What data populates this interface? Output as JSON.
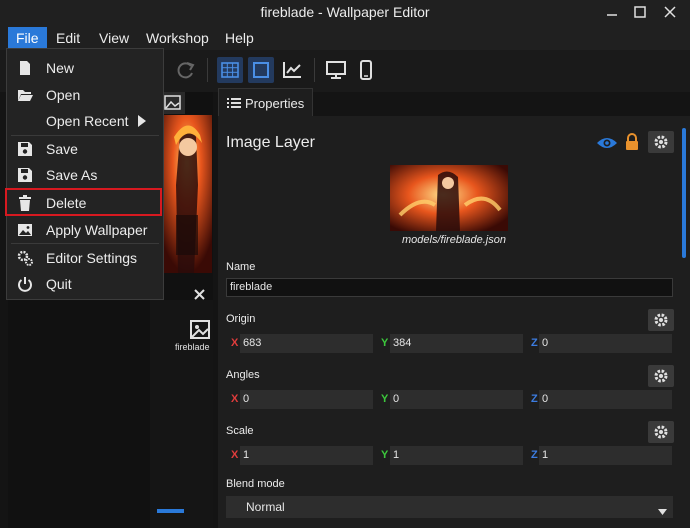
{
  "window": {
    "title": "fireblade - Wallpaper Editor"
  },
  "menubar": {
    "items": [
      "File",
      "Edit",
      "View",
      "Workshop",
      "Help"
    ],
    "active": "File"
  },
  "file_menu": {
    "items": [
      {
        "label": "New",
        "icon": "file-icon"
      },
      {
        "label": "Open",
        "icon": "folder-open-icon"
      },
      {
        "label": "Open Recent",
        "icon": "none",
        "submenu": true
      },
      {
        "label": "Save",
        "icon": "floppy-icon"
      },
      {
        "label": "Save As",
        "icon": "floppy-icon"
      },
      {
        "label": "Delete",
        "icon": "trash-icon",
        "highlighted": true
      },
      {
        "label": "Apply Wallpaper",
        "icon": "image-icon"
      },
      {
        "label": "Editor Settings",
        "icon": "gears-icon"
      },
      {
        "label": "Quit",
        "icon": "power-icon"
      }
    ]
  },
  "toolbar": {
    "buttons": [
      "redo-icon",
      "grid-icon",
      "square-icon",
      "chart-icon",
      "monitor-icon",
      "phone-icon"
    ],
    "active": [
      "grid-icon",
      "square-icon"
    ]
  },
  "assets": {
    "item_label": "fireblade"
  },
  "properties": {
    "tab_label": "Properties",
    "header": "Image Layer",
    "model_path": "models/fireblade.json",
    "name": {
      "label": "Name",
      "value": "fireblade"
    },
    "origin": {
      "label": "Origin",
      "x": "683",
      "y": "384",
      "z": "0"
    },
    "angles": {
      "label": "Angles",
      "x": "0",
      "y": "0",
      "z": "0"
    },
    "scale": {
      "label": "Scale",
      "x": "1",
      "y": "1",
      "z": "1"
    },
    "blend_mode": {
      "label": "Blend mode",
      "value": "Normal"
    },
    "axis": {
      "x": "X",
      "y": "Y",
      "z": "Z"
    }
  },
  "colors": {
    "accent": "#2a79d9",
    "highlight_border": "#d71920",
    "lock": "#e8912d",
    "axis_x": "#e03c3c",
    "axis_y": "#3cc83c",
    "axis_z": "#3c7ce0"
  }
}
